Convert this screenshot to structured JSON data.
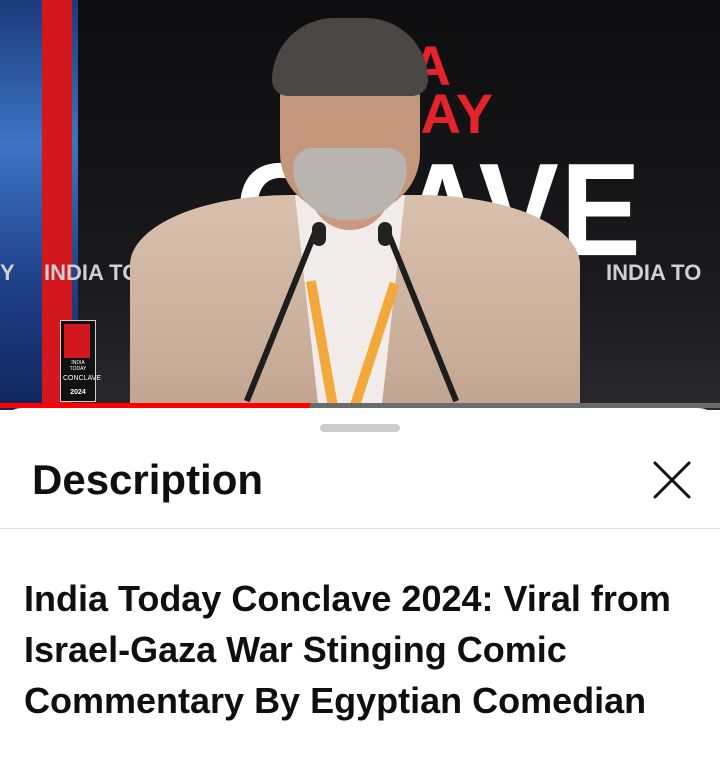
{
  "video": {
    "backdrop_text": {
      "line1": "IA",
      "line2": "DAY",
      "line3": "CLAVE"
    },
    "ticker": [
      "Y",
      "INDIA TO",
      "Y",
      "INDIA TO"
    ],
    "logo": {
      "line1": "INDIA",
      "line2": "TODAY",
      "line3": "CONCLAVE",
      "line4": "2024"
    },
    "progress_fraction": 0.43,
    "progress_color": "#ff0000"
  },
  "sheet": {
    "title": "Description",
    "close_icon": "close-icon",
    "video_title": "India Today Conclave 2024: Viral from Israel-Gaza War Stinging Comic Commentary By Egyptian Comedian"
  },
  "colors": {
    "brand_red": "#d3171f",
    "text_primary": "#0f0f0f",
    "divider": "#dcdcdc"
  }
}
